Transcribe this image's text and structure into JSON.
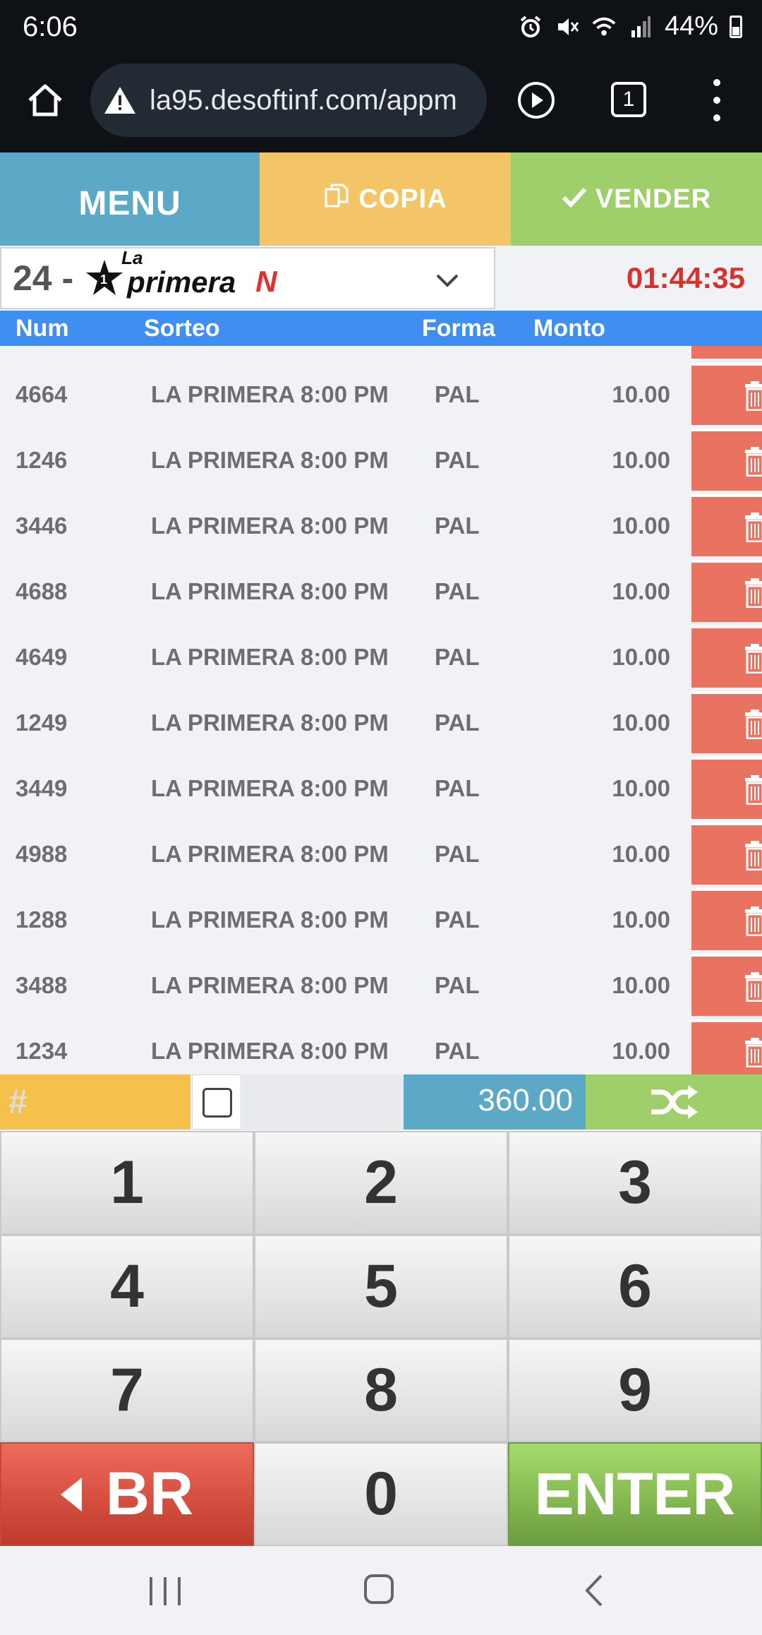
{
  "status_bar": {
    "time": "6:06",
    "battery": "44%",
    "icons": [
      "alarm-icon",
      "mute-icon",
      "wifi-icon",
      "signal-icon",
      "battery-icon"
    ]
  },
  "browser": {
    "url": "la95.desoftinf.com/appm",
    "tab_count": "1"
  },
  "actions": {
    "menu_label": "MENU",
    "copia_label": "COPIA",
    "vender_label": "VENDER"
  },
  "selector": {
    "number": "24 -",
    "logo_la": "La",
    "logo_primera": "primera",
    "logo_n": "N",
    "countdown": "01:44:35"
  },
  "table": {
    "headers": {
      "num": "Num",
      "sorteo": "Sorteo",
      "forma": "Forma",
      "monto": "Monto"
    },
    "rows": [
      {
        "num": "4664",
        "sorteo": "LA PRIMERA 8:00 PM",
        "forma": "PAL",
        "monto": "10.00"
      },
      {
        "num": "1246",
        "sorteo": "LA PRIMERA 8:00 PM",
        "forma": "PAL",
        "monto": "10.00"
      },
      {
        "num": "3446",
        "sorteo": "LA PRIMERA 8:00 PM",
        "forma": "PAL",
        "monto": "10.00"
      },
      {
        "num": "4688",
        "sorteo": "LA PRIMERA 8:00 PM",
        "forma": "PAL",
        "monto": "10.00"
      },
      {
        "num": "4649",
        "sorteo": "LA PRIMERA 8:00 PM",
        "forma": "PAL",
        "monto": "10.00"
      },
      {
        "num": "1249",
        "sorteo": "LA PRIMERA 8:00 PM",
        "forma": "PAL",
        "monto": "10.00"
      },
      {
        "num": "3449",
        "sorteo": "LA PRIMERA 8:00 PM",
        "forma": "PAL",
        "monto": "10.00"
      },
      {
        "num": "4988",
        "sorteo": "LA PRIMERA 8:00 PM",
        "forma": "PAL",
        "monto": "10.00"
      },
      {
        "num": "1288",
        "sorteo": "LA PRIMERA 8:00 PM",
        "forma": "PAL",
        "monto": "10.00"
      },
      {
        "num": "3488",
        "sorteo": "LA PRIMERA 8:00 PM",
        "forma": "PAL",
        "monto": "10.00"
      },
      {
        "num": "1234",
        "sorteo": "LA PRIMERA 8:00 PM",
        "forma": "PAL",
        "monto": "10.00"
      }
    ]
  },
  "input_bar": {
    "number_placeholder": "#",
    "total": "360.00"
  },
  "keypad": {
    "keys": [
      "1",
      "2",
      "3",
      "4",
      "5",
      "6",
      "7",
      "8",
      "9"
    ],
    "br_label": "BR",
    "zero": "0",
    "enter_label": "ENTER"
  },
  "colors": {
    "menu": "#5ca9c7",
    "copia": "#f4c566",
    "vender": "#9fcf6a",
    "header": "#3f8ef2",
    "delete": "#e97360",
    "countdown": "#d9322b"
  }
}
